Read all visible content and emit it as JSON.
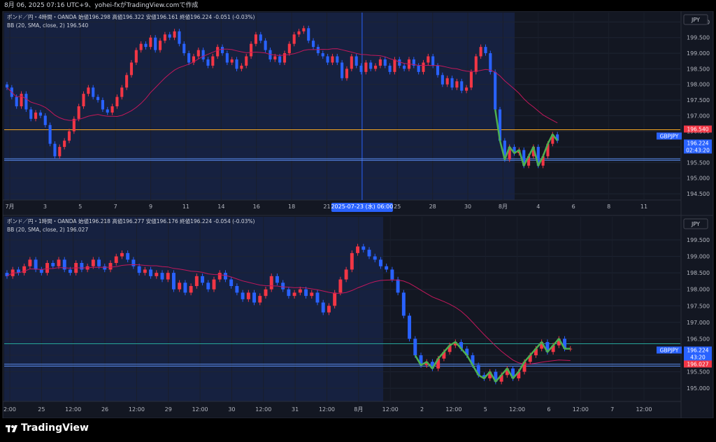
{
  "header": {
    "text": "8月 06, 2025 07:16 UTC+9、yohei-fxがTradingView.comで作成"
  },
  "brand": {
    "name": "TradingView"
  },
  "chart_data": [
    {
      "type": "candlestick",
      "panel": "top",
      "timeframe": "4時間",
      "legend": {
        "symbol": "ポンド／円・4時間・OANDA",
        "open_label": "始値",
        "open": "196.298",
        "high_label": "高値",
        "high": "196.322",
        "low_label": "安値",
        "low": "196.161",
        "close_label": "終値",
        "close": "196.224",
        "change": "-0.051 (-0.03%)",
        "indicator": "BB (20, SMA, close, 2)",
        "indicator_value": "196.540"
      },
      "currency": "JPY",
      "y_ticks": [
        "200.000",
        "199.500",
        "199.000",
        "198.500",
        "198.000",
        "197.500",
        "197.000",
        "196.500",
        "196.000",
        "195.500",
        "195.000",
        "194.500"
      ],
      "ylim": [
        194.3,
        200.3
      ],
      "x_ticks": [
        "7月",
        "3",
        "5",
        "7",
        "9",
        "11",
        "14",
        "16",
        "18",
        "21",
        "2025-07-23 (水)  06:00",
        "25",
        "28",
        "30",
        "8月",
        "4",
        "6",
        "8",
        "11"
      ],
      "price_labels": [
        {
          "text": "196.540",
          "color": "#f23645"
        },
        {
          "text": "GBPJPY",
          "color": "#2962ff"
        },
        {
          "text": "196.224",
          "color": "#2962ff"
        },
        {
          "text": "02:43:20",
          "color": "#2962ff"
        }
      ],
      "horizontal_levels": [
        {
          "value": 196.55,
          "color": "#f5a623"
        },
        {
          "value": 195.62,
          "color": "#5b8def"
        },
        {
          "value": 195.57,
          "color": "#5b8def"
        }
      ],
      "closes": [
        197.9,
        197.6,
        197.3,
        197.7,
        197.2,
        196.9,
        197.1,
        197.0,
        196.7,
        196.1,
        195.7,
        196.0,
        196.2,
        196.5,
        196.9,
        197.3,
        197.7,
        197.9,
        197.6,
        197.5,
        197.2,
        197.1,
        197.3,
        197.6,
        197.9,
        198.3,
        198.7,
        199.1,
        199.3,
        199.2,
        199.5,
        199.1,
        199.4,
        199.6,
        199.5,
        199.7,
        199.3,
        199.0,
        198.7,
        198.9,
        199.1,
        198.8,
        198.6,
        198.9,
        199.2,
        199.0,
        198.7,
        198.8,
        198.5,
        198.6,
        198.9,
        199.3,
        199.6,
        199.4,
        199.1,
        198.8,
        198.9,
        198.7,
        199.0,
        199.3,
        199.6,
        199.7,
        199.8,
        199.4,
        199.2,
        199.0,
        198.9,
        198.7,
        198.9,
        198.7,
        198.2,
        198.5,
        198.9,
        198.6,
        198.4,
        198.7,
        198.5,
        198.6,
        198.8,
        198.6,
        198.4,
        198.8,
        198.6,
        198.5,
        198.8,
        198.6,
        198.4,
        198.7,
        198.9,
        198.6,
        198.3,
        198.0,
        198.2,
        197.9,
        198.1,
        197.8,
        197.9,
        198.4,
        198.9,
        199.2,
        199.0,
        198.4,
        197.2,
        196.2,
        195.6,
        196.0,
        195.8,
        195.9,
        195.4,
        195.7,
        196.0,
        195.4,
        195.7,
        196.1,
        196.4,
        196.2
      ]
    },
    {
      "type": "candlestick",
      "panel": "bottom",
      "timeframe": "1時間",
      "legend": {
        "symbol": "ポンド／円・1時間・OANDA",
        "open_label": "始値",
        "open": "196.218",
        "high_label": "高値",
        "high": "196.277",
        "low_label": "安値",
        "low": "196.176",
        "close_label": "終値",
        "close": "196.224",
        "change": "-0.054 (-0.03%)",
        "indicator": "BB (20, SMA, close, 2)",
        "indicator_value": "196.027"
      },
      "currency": "JPY",
      "y_ticks": [
        "199.500",
        "199.000",
        "198.500",
        "198.000",
        "197.500",
        "197.000",
        "196.500",
        "196.000",
        "195.500",
        "195.000"
      ],
      "ylim": [
        194.6,
        200.2
      ],
      "x_ticks": [
        "2:00",
        "25",
        "12:00",
        "26",
        "12:00",
        "29",
        "12:00",
        "30",
        "12:00",
        "31",
        "12:00",
        "8月",
        "12:00",
        "2",
        "12:00",
        "5",
        "12:00",
        "6",
        "12:00",
        "7",
        "12:00"
      ],
      "price_labels": [
        {
          "text": "GBPJPY",
          "color": "#2962ff"
        },
        {
          "text": "196.224",
          "color": "#2962ff"
        },
        {
          "text": "43:20",
          "color": "#2962ff"
        },
        {
          "text": "196.027",
          "color": "#f23645"
        }
      ],
      "horizontal_levels": [
        {
          "value": 196.35,
          "color": "#26a69a"
        },
        {
          "value": 195.73,
          "color": "#5b8def"
        },
        {
          "value": 195.67,
          "color": "#5b8def"
        }
      ],
      "closes": [
        198.4,
        198.6,
        198.5,
        198.7,
        198.9,
        198.6,
        198.5,
        198.8,
        198.7,
        198.9,
        198.6,
        198.5,
        198.8,
        198.6,
        198.7,
        198.9,
        198.7,
        198.6,
        198.8,
        199.0,
        199.1,
        198.9,
        198.7,
        198.5,
        198.6,
        198.4,
        198.5,
        198.3,
        198.5,
        198.0,
        198.2,
        197.9,
        198.1,
        198.4,
        198.2,
        198.0,
        198.3,
        198.5,
        198.3,
        198.1,
        197.9,
        197.7,
        197.9,
        197.6,
        197.8,
        198.0,
        198.4,
        198.2,
        198.0,
        197.8,
        197.9,
        198.0,
        197.8,
        197.9,
        197.6,
        197.3,
        197.5,
        197.9,
        198.3,
        198.6,
        199.1,
        199.3,
        199.2,
        199.0,
        198.9,
        198.7,
        198.6,
        198.3,
        197.9,
        197.2,
        196.5,
        196.0,
        195.7,
        195.8,
        195.6,
        195.9,
        196.1,
        196.3,
        196.4,
        196.2,
        196.0,
        195.7,
        195.4,
        195.3,
        195.5,
        195.2,
        195.4,
        195.6,
        195.3,
        195.5,
        195.8,
        196.0,
        196.2,
        196.4,
        196.1,
        196.3,
        196.5,
        196.2,
        196.2
      ]
    }
  ]
}
